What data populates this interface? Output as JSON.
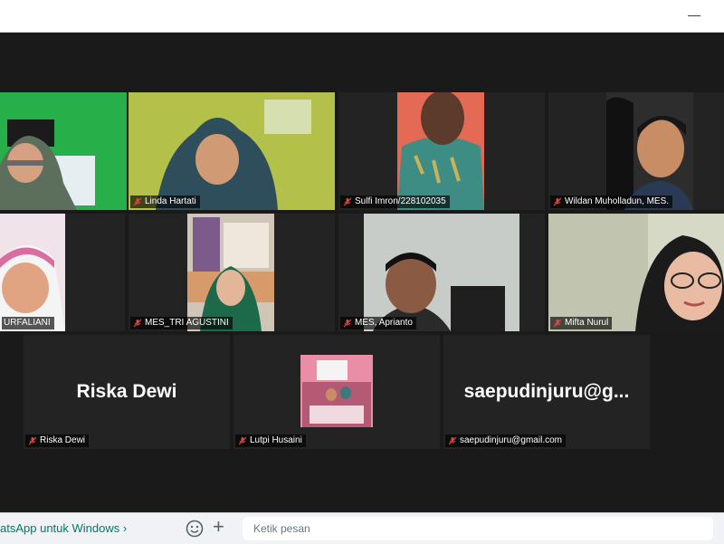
{
  "window": {
    "minimize_glyph": "—"
  },
  "participants": [
    {
      "name": "",
      "muted": false,
      "active": true
    },
    {
      "name": "Linda Hartati",
      "muted": true
    },
    {
      "name": "Sulfi Imron/228102035",
      "muted": true
    },
    {
      "name": "Wildan Muholladun, MES.",
      "muted": true
    },
    {
      "name": "URFALIANI",
      "muted": true
    },
    {
      "name": "MES_TRI AGUSTINI",
      "muted": true
    },
    {
      "name": "MES, Aprianto",
      "muted": true
    },
    {
      "name": "Mifta Nurul",
      "muted": true
    },
    {
      "name": "Riska Dewi",
      "display_name": "Riska Dewi",
      "muted": true,
      "video": false
    },
    {
      "name": "Lutpi Husaini",
      "muted": true
    },
    {
      "name": "saepudinjuru@gmail.com",
      "display_name": "saepudinjuru@g...",
      "muted": true,
      "video": false
    }
  ],
  "whatsapp": {
    "link_text": "atsApp untuk Windows",
    "chevron": "›",
    "add_glyph": "+",
    "message_placeholder": "Ketik pesan"
  },
  "colors": {
    "active_border": "#d9e36b",
    "muted_mic": "#e0463c",
    "whatsapp_green": "#00796b"
  }
}
